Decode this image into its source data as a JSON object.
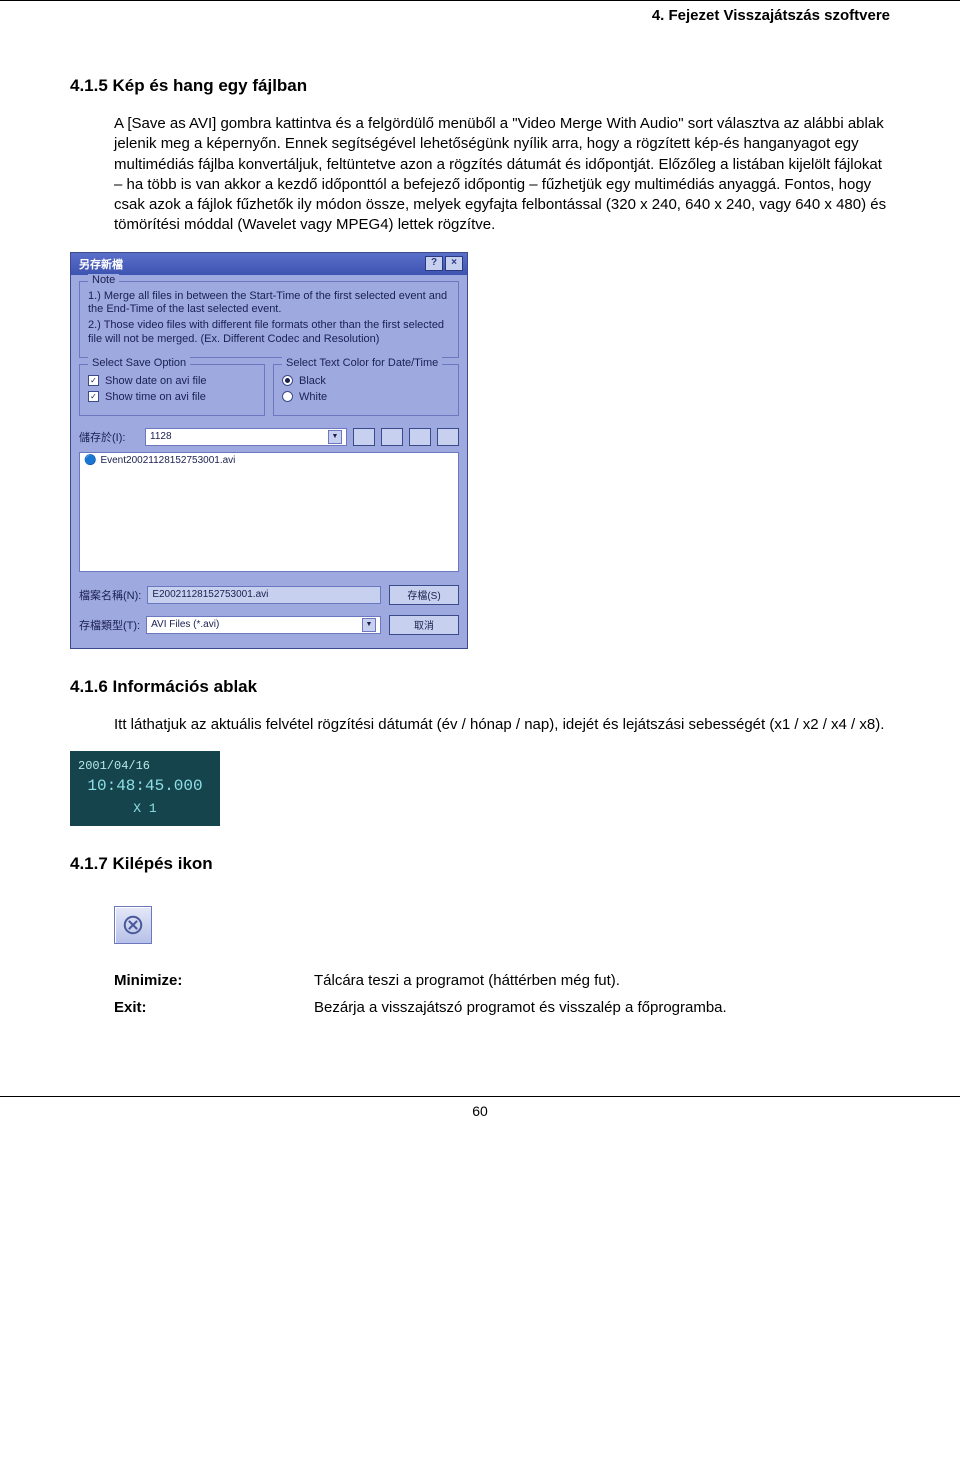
{
  "header": {
    "chapter": "4. Fejezet   Visszajátszás szoftvere"
  },
  "sec1": {
    "heading": "4.1.5 Kép és hang egy fájlban",
    "para": "A [Save as AVI] gombra kattintva és a felgördülő menüből a \"Video Merge With Audio\" sort választva az alábbi ablak jelenik meg a képernyőn. Ennek segítségével lehetőségünk nyílik arra, hogy a rögzített kép-és hanganyagot egy multimédiás fájlba konvertáljuk, feltüntetve azon a rögzítés dátumát és időpontját. Előzőleg a listában kijelölt fájlokat – ha több is van akkor a kezdő időponttól a befejező időpontig – fűzhetjük egy multimédiás anyaggá. Fontos, hogy csak azok a fájlok fűzhetők ily módon össze, melyek egyfajta felbontással (320 x 240, 640 x 240, vagy 640 x 480) és tömörítési móddal (Wavelet vagy MPEG4) lettek rögzítve."
  },
  "dialog": {
    "title": "另存新檔",
    "help": "?",
    "close": "×",
    "note_legend": "Note",
    "note1": "1.) Merge all files in between the Start-Time of the first selected event and the End-Time of the last selected event.",
    "note2": "2.) Those video files with different file formats other than the first selected file will not be merged. (Ex. Different Codec and Resolution)",
    "save_legend": "Select Save Option",
    "color_legend": "Select Text Color for Date/Time",
    "chk_date": "Show date on avi file",
    "chk_time": "Show time on avi file",
    "radio_black": "Black",
    "radio_white": "White",
    "save_in_label": "儲存於(I):",
    "save_in_value": "1128",
    "list_item": "Event20021128152753001.avi",
    "name_label": "檔案名稱(N):",
    "name_value": "E20021128152753001.avi",
    "type_label": "存檔類型(T):",
    "type_value": "AVI Files (*.avi)",
    "save_btn": "存檔(S)",
    "cancel_btn": "取消"
  },
  "sec2": {
    "heading": "4.1.6 Információs ablak",
    "para": "Itt láthatjuk az aktuális felvétel rögzítési dátumát (év / hónap / nap), idejét és lejátszási sebességét (x1 / x2 / x4 / x8)."
  },
  "infopanel": {
    "date": "2001/04/16",
    "time": "10:48:45.000",
    "speed": "X 1"
  },
  "sec3": {
    "heading": "4.1.7 Kilépés ikon"
  },
  "defs": {
    "minimize_term": "Minimize:",
    "minimize_desc": "Tálcára teszi a programot (háttérben még fut).",
    "exit_term": "Exit:",
    "exit_desc": "Bezárja a visszajátszó programot és visszalép a főprogramba."
  },
  "pagenum": "60"
}
